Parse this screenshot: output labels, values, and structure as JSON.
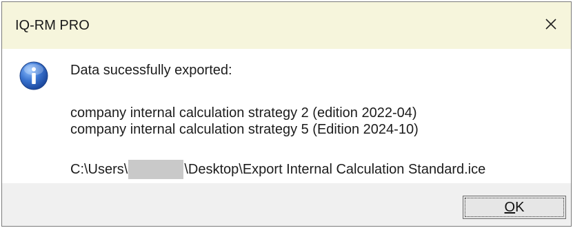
{
  "window": {
    "title": "IQ-RM PRO",
    "close_glyph": "✕"
  },
  "icon": {
    "name": "info-icon",
    "glyph": "i",
    "color": "#2b5fb3"
  },
  "message": {
    "heading": "Data sucessfully exported:",
    "lines": [
      "company internal calculation strategy 2 (edition 2022-04)",
      "company internal calculation strategy 5 (Edition 2024-10)"
    ],
    "path_prefix": "C:\\Users\\",
    "path_suffix": "\\Desktop\\Export Internal Calculation Standard.ice"
  },
  "buttons": {
    "ok_mnemonic": "O",
    "ok_rest": "K"
  },
  "colors": {
    "titlebar_bg": "#f6f5dc",
    "footer_bg": "#f0f0f0",
    "redaction": "#c9c9c9"
  }
}
